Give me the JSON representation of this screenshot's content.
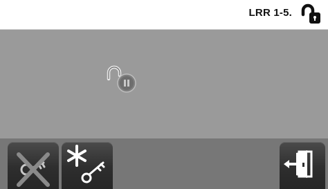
{
  "header": {
    "title": "LRR 1-5.",
    "lock_icon": "unlocked-padlock-icon"
  },
  "main": {
    "status_icon": "unlocked-padlock-icon"
  },
  "bottom_bar": {
    "buttons": [
      {
        "name": "delete-key-button",
        "icon": "key-crossed-out-icon"
      },
      {
        "name": "add-key-button",
        "icon": "asterisk-key-icon"
      },
      {
        "name": "exit-button",
        "icon": "exit-door-icon"
      }
    ]
  },
  "colors": {
    "header_bg": "#ffffff",
    "screen_bg": "#9a9a9a",
    "button_bg": "#2e2e2e",
    "icon_fg": "#ffffff"
  }
}
